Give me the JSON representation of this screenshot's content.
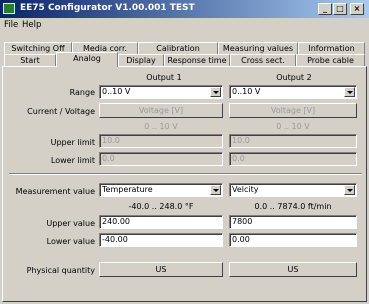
{
  "window": {
    "title": "EE75 Configurator V1.00.001 TEST",
    "minimize": "_",
    "maximize": "□",
    "close": "×"
  },
  "menu": {
    "file": "File",
    "help": "Help"
  },
  "tabs_row1": [
    "Switching Off",
    "Media corr.",
    "Calibration",
    "Measuring values",
    "Information"
  ],
  "tabs_row2": [
    "Start",
    "Analog",
    "Display",
    "Response time",
    "Cross sect.",
    "Probe cable"
  ],
  "active_tab": "Analog",
  "output1": {
    "header": "Output 1",
    "range": "0..10 V",
    "current_voltage_button": "Voltage [V]",
    "range_hint": "0 .. 10 V",
    "upper_limit": "10.0",
    "lower_limit": "0.0",
    "measurement_value": "Temperature",
    "measurement_hint": "-40.0 .. 248.0 °F",
    "upper_value": "240.00",
    "lower_value": "-40.00",
    "physical_quantity_button": "US"
  },
  "output2": {
    "header": "Output 2",
    "range": "0..10 V",
    "current_voltage_button": "Voltage [V]",
    "range_hint": "0 .. 10 V",
    "upper_limit": "10.0",
    "lower_limit": "0.0",
    "measurement_value": "Velcity",
    "measurement_hint": "0.0 .. 7874.0 ft/min",
    "upper_value": "7800",
    "lower_value": "0.00",
    "physical_quantity_button": "US"
  },
  "labels": {
    "range": "Range",
    "current_voltage": "Current / Voltage",
    "upper_limit": "Upper limit",
    "lower_limit": "Lower limit",
    "measurement_value": "Measurement value",
    "upper_value": "Upper value",
    "lower_value": "Lower value",
    "physical_quantity": "Physical quantity"
  }
}
